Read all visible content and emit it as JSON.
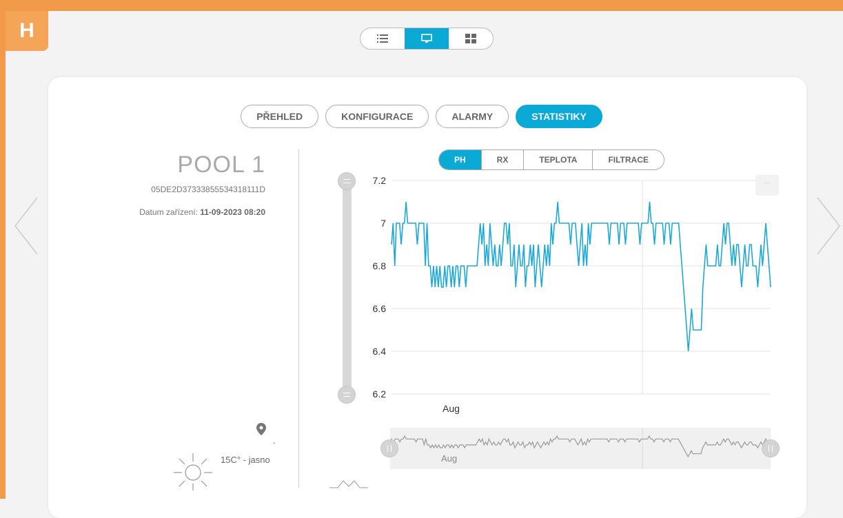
{
  "logo": {
    "letter": "H",
    "color": "#f19a4a"
  },
  "view_switch": {
    "buttons": [
      {
        "icon": "list-icon",
        "active": false
      },
      {
        "icon": "monitor-icon",
        "active": true
      },
      {
        "icon": "grid-icon",
        "active": false
      }
    ]
  },
  "tabs": [
    {
      "label": "PŘEHLED",
      "active": false
    },
    {
      "label": "KONFIGURACE",
      "active": false
    },
    {
      "label": "ALARMY",
      "active": false
    },
    {
      "label": "STATISTIKY",
      "active": true
    }
  ],
  "device": {
    "name": "POOL 1",
    "id": "05DE2D37333855534318111D",
    "date_label": "Datum zařízení: ",
    "date_value": "11-09-2023 08:20",
    "location": "-",
    "weather": "15C° - jasno"
  },
  "metric_tabs": [
    {
      "label": "PH",
      "active": true
    },
    {
      "label": "RX",
      "active": false
    },
    {
      "label": "TEPLOTA",
      "active": false
    },
    {
      "label": "FILTRACE",
      "active": false
    }
  ],
  "colors": {
    "accent": "#0aa9d6",
    "brand": "#f19a4a"
  },
  "chart_data": {
    "type": "line",
    "series_color": "#1aa9d6",
    "ylim": [
      6.2,
      7.2
    ],
    "yticks": [
      "7.2",
      "7",
      "6.8",
      "6.6",
      "6.4",
      "6.2"
    ],
    "x_tick_label": "Aug",
    "navigator_label": "Aug",
    "y": [
      6.9,
      7,
      6.8,
      7,
      7,
      7,
      6.9,
      7,
      7,
      7.1,
      7,
      7,
      7,
      7,
      7,
      7,
      6.9,
      7,
      7,
      7,
      7,
      6.8,
      7,
      6.8,
      6.8,
      6.7,
      6.8,
      6.7,
      6.8,
      6.7,
      6.8,
      6.7,
      6.7,
      6.8,
      6.7,
      6.8,
      6.8,
      6.7,
      6.8,
      6.7,
      6.8,
      6.8,
      6.7,
      6.8,
      6.8,
      6.8,
      6.7,
      6.8,
      6.8,
      6.8,
      6.8,
      6.8,
      6.8,
      6.8,
      6.9,
      7,
      6.9,
      7,
      6.8,
      6.9,
      6.8,
      7,
      6.9,
      6.8,
      6.9,
      6.8,
      6.8,
      6.9,
      6.8,
      6.9,
      7,
      7,
      6.9,
      7,
      6.8,
      6.8,
      6.9,
      6.7,
      6.8,
      6.9,
      6.8,
      6.8,
      6.9,
      6.7,
      6.8,
      6.8,
      6.9,
      6.8,
      6.9,
      6.7,
      6.8,
      6.9,
      6.8,
      6.7,
      6.8,
      6.9,
      6.8,
      6.9,
      6.8,
      7,
      6.9,
      7,
      7,
      7.1,
      7,
      7,
      7,
      7,
      7,
      7,
      7,
      6.9,
      7,
      7,
      7,
      6.9,
      6.8,
      6.9,
      7,
      6.8,
      6.9,
      6.8,
      7,
      6.9,
      7,
      7,
      7,
      7,
      7,
      7,
      7,
      7,
      7,
      7,
      7,
      6.9,
      7,
      7,
      7,
      7,
      7,
      6.9,
      7,
      7,
      7,
      6.9,
      7,
      7,
      7,
      7,
      7,
      7,
      7,
      7,
      6.9,
      7,
      7,
      7,
      7,
      7,
      7.1,
      7,
      7,
      6.9,
      7,
      7,
      7,
      7,
      7,
      6.9,
      7,
      7,
      7,
      6.9,
      7,
      7,
      7,
      7,
      7,
      6.9,
      6.8,
      6.7,
      6.6,
      6.5,
      6.4,
      6.5,
      6.6,
      6.5,
      6.5,
      6.5,
      6.5,
      6.5,
      6.5,
      6.7,
      6.8,
      6.9,
      6.8,
      6.8,
      6.8,
      6.8,
      6.8,
      6.8,
      6.9,
      6.8,
      6.8,
      6.9,
      7,
      6.9,
      7,
      7,
      6.9,
      6.8,
      6.9,
      6.8,
      6.9,
      6.9,
      6.8,
      6.7,
      6.8,
      6.9,
      6.8,
      6.8,
      6.9,
      6.9,
      6.8,
      6.8,
      6.8,
      6.7,
      6.8,
      6.9,
      6.8,
      6.9,
      7,
      6.9,
      6.8,
      6.7
    ]
  }
}
